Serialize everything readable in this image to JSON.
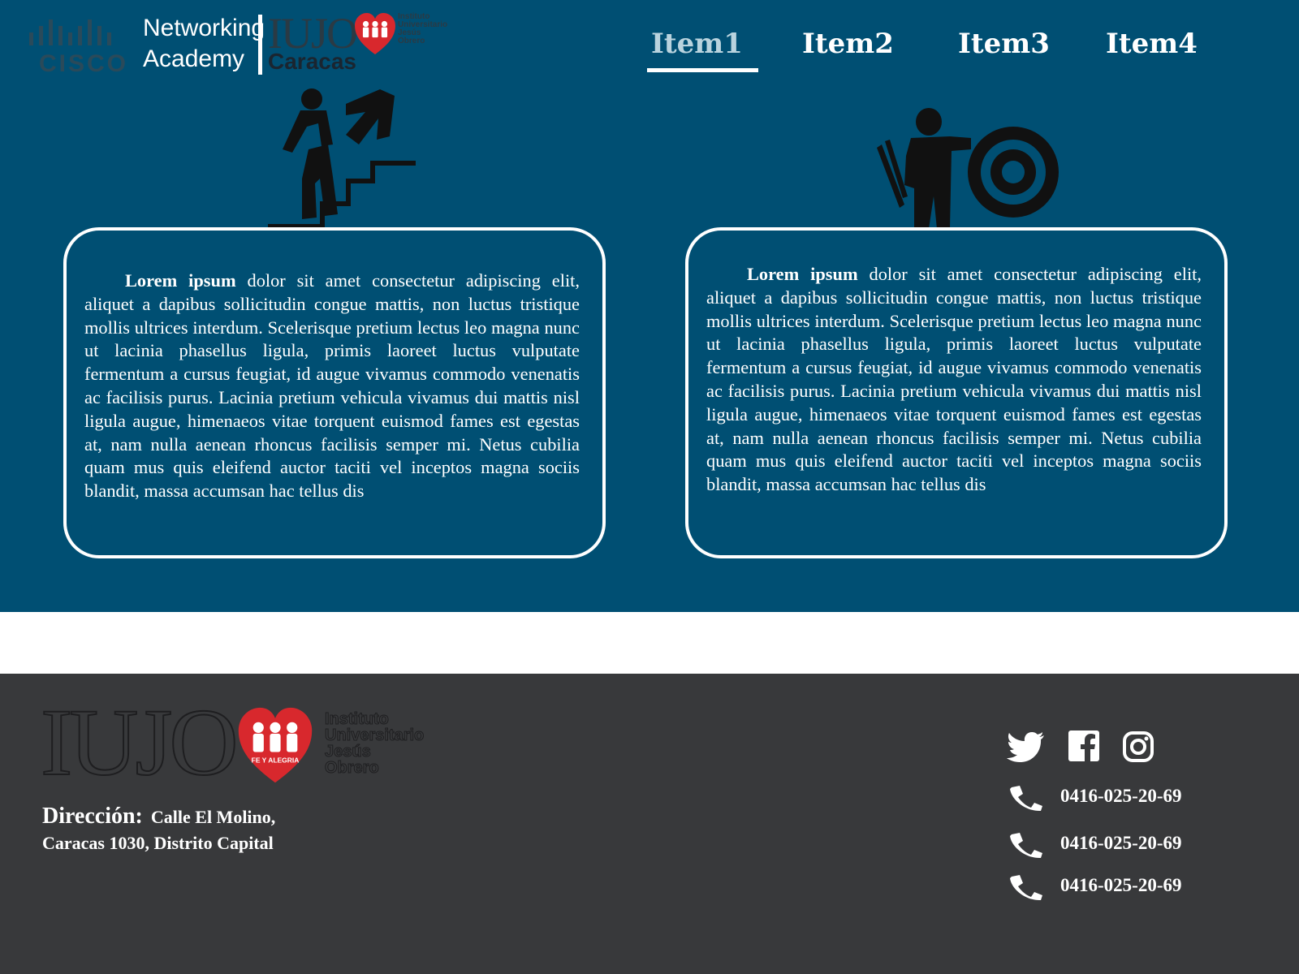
{
  "header": {
    "cisco_word": "CISCO",
    "academy_line1": "Networking",
    "academy_line2": "Academy",
    "iujo_word": "IUJO",
    "iujo_city": "Caracas",
    "iujo_institute": [
      "Instituto",
      "Universitario",
      "Jesús",
      "Obrero"
    ],
    "heart_text": "FE Y ALEGRIA",
    "nav": [
      {
        "label": "Item1",
        "active": true
      },
      {
        "label": "Item2",
        "active": false
      },
      {
        "label": "Item3",
        "active": false
      },
      {
        "label": "Item4",
        "active": false
      }
    ]
  },
  "cards": [
    {
      "icon": "climbing-stairs-icon",
      "lead": "Lorem ipsum",
      "body": " dolor sit amet consectetur adipiscing elit, aliquet a dapibus sollicitudin congue mattis, non luctus tristique mollis ultrices interdum. Scelerisque pretium lectus leo magna nunc ut lacinia phasellus ligula, primis laoreet luctus vulputate fermentum a cursus feugiat, id augue vivamus commodo venenatis ac facilisis purus. Lacinia pretium vehicula vivamus dui mattis nisl ligula augue, himenaeos vitae torquent euismod fames est egestas at, nam nulla aenean rhoncus facilisis semper mi. Netus cubilia quam mus quis eleifend auctor taciti vel inceptos magna sociis blandit, massa accumsan hac tellus dis"
    },
    {
      "icon": "archer-target-icon",
      "lead": "Lorem ipsum",
      "body": " dolor sit amet consectetur adipiscing elit, aliquet a dapibus sollicitudin congue mattis, non luctus tristique mollis ultrices interdum. Scelerisque pretium lectus leo magna nunc ut lacinia phasellus ligula, primis laoreet luctus vulputate fermentum a cursus feugiat, id augue vivamus commodo venenatis ac facilisis purus. Lacinia pretium vehicula vivamus dui mattis nisl ligula augue, himenaeos vitae torquent euismod fames est egestas at, nam nulla aenean rhoncus facilisis semper mi. Netus cubilia quam mus quis eleifend auctor taciti vel inceptos magna sociis blandit, massa accumsan hac tellus dis"
    }
  ],
  "footer": {
    "iujo_word": "IUJO",
    "institute": [
      "Instituto",
      "Universitario",
      "Jesús",
      "Obrero"
    ],
    "heart_text": "FE Y ALEGRIA",
    "address_label": "Dirección:",
    "address_line1": "Calle El Molino,",
    "address_line2": "Caracas 1030, Distrito Capital",
    "social": [
      "twitter-icon",
      "facebook-icon",
      "instagram-icon"
    ],
    "phones": [
      "0416-025-20-69",
      "0416-025-20-69",
      "0416-025-20-69"
    ]
  },
  "colors": {
    "header_bg": "#004f73",
    "footer_bg": "#38393b",
    "heart_red": "#d8282d",
    "nav_active": "#b9d3de"
  }
}
